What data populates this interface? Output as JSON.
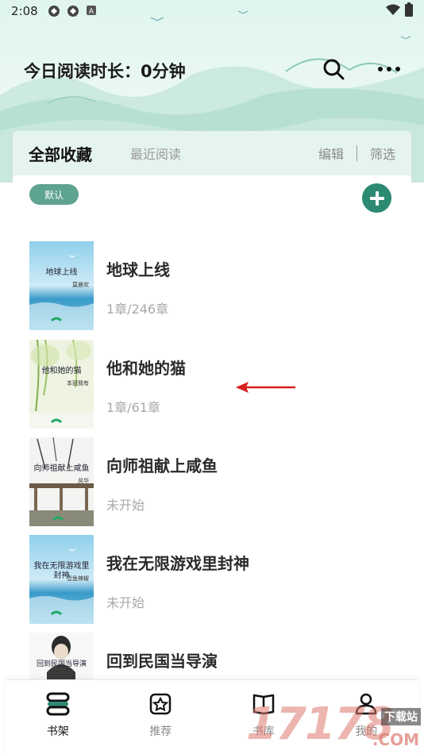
{
  "status_bar": {
    "time": "2:08",
    "icons": [
      "app-icon",
      "app-icon",
      "text-a-icon"
    ],
    "right_icons": [
      "wifi-icon",
      "battery-icon"
    ]
  },
  "header": {
    "reading_time": "今日阅读时长：0分钟",
    "search_icon": "search-icon",
    "more_icon": "more-icon"
  },
  "tabs": {
    "active": "全部收藏",
    "inactive": "最近阅读",
    "edit": "编辑",
    "filter": "筛选"
  },
  "group": {
    "pill_label": "默认",
    "add_icon": "add-icon"
  },
  "books": [
    {
      "title": "地球上线",
      "progress": "1章/246章",
      "cover_title": "地球上线",
      "cover_author": "莫晨欢",
      "cover_style": "sea"
    },
    {
      "title": "他和她的猫",
      "progress": "1章/61章",
      "cover_title": "他和她的猫",
      "cover_author": "本冠我有",
      "cover_style": "willow"
    },
    {
      "title": "向师祖献上咸鱼",
      "progress": "未开始",
      "cover_title": "向师祖献上咸鱼",
      "cover_author": "凤华",
      "cover_style": "pavilion"
    },
    {
      "title": "我在无限游戏里封神",
      "progress": "未开始",
      "cover_title": "我在无限游戏里封神",
      "cover_author": "壶鱼辣椒",
      "cover_style": "sea"
    },
    {
      "title": "回到民国当导演",
      "progress": "",
      "cover_title": "回到民国当导演",
      "cover_author": "",
      "cover_style": "portrait"
    }
  ],
  "bottom_nav": [
    {
      "label": "书架",
      "icon": "bookshelf-icon",
      "active": true
    },
    {
      "label": "推荐",
      "icon": "recommend-icon",
      "active": false
    },
    {
      "label": "书库",
      "icon": "library-icon",
      "active": false
    },
    {
      "label": "我的",
      "icon": "profile-icon",
      "active": false
    }
  ],
  "watermark": {
    "main": "17178",
    "sub": "下载站",
    "com": ".COM"
  },
  "colors": {
    "accent": "#2d8a72",
    "pill": "#5fa391",
    "hero_bg": "#dff5ee",
    "annotation_arrow": "#d62020"
  }
}
